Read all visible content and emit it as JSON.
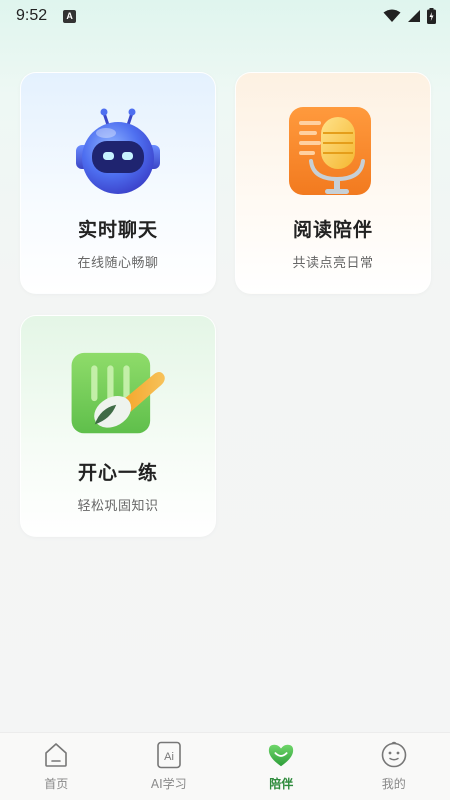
{
  "status_bar": {
    "time": "9:52",
    "notification_letter": "A"
  },
  "cards": [
    {
      "title": "实时聊天",
      "subtitle": "在线随心畅聊",
      "icon": "robot-icon"
    },
    {
      "title": "阅读陪伴",
      "subtitle": "共读点亮日常",
      "icon": "microphone-icon"
    },
    {
      "title": "开心一练",
      "subtitle": "轻松巩固知识",
      "icon": "brush-icon"
    }
  ],
  "tab_bar": {
    "tabs": [
      {
        "label": "首页",
        "icon": "home-icon",
        "active": false
      },
      {
        "label": "AI学习",
        "icon": "ai-icon",
        "icon_text": "Ai",
        "active": false
      },
      {
        "label": "陪伴",
        "icon": "companion-icon",
        "active": true
      },
      {
        "label": "我的",
        "icon": "profile-icon",
        "active": false
      }
    ],
    "active_color": "#2e8b3c"
  }
}
